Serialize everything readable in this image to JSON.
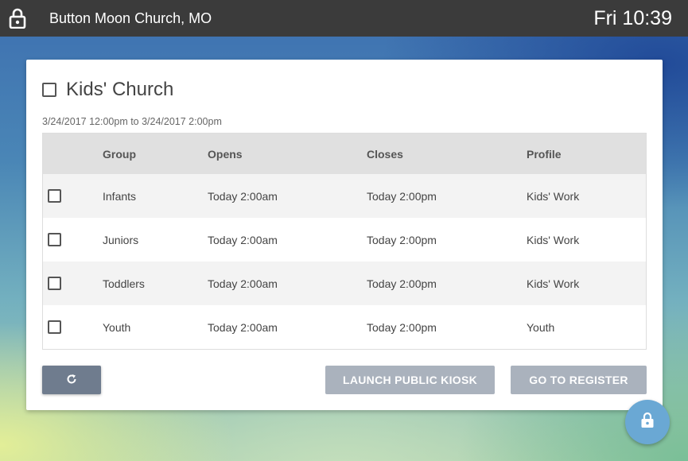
{
  "topbar": {
    "lock_icon": "lock-icon",
    "church_name": "Button Moon Church, MO",
    "clock": "Fri 10:39"
  },
  "event": {
    "title": "Kids' Church",
    "time_range": "3/24/2017 12:00pm to 3/24/2017 2:00pm"
  },
  "table": {
    "headers": {
      "group": "Group",
      "opens": "Opens",
      "closes": "Closes",
      "profile": "Profile"
    },
    "rows": [
      {
        "group": "Infants",
        "opens": "Today 2:00am",
        "closes": "Today 2:00pm",
        "profile": "Kids' Work"
      },
      {
        "group": "Juniors",
        "opens": "Today 2:00am",
        "closes": "Today 2:00pm",
        "profile": "Kids' Work"
      },
      {
        "group": "Toddlers",
        "opens": "Today 2:00am",
        "closes": "Today 2:00pm",
        "profile": "Kids' Work"
      },
      {
        "group": "Youth",
        "opens": "Today 2:00am",
        "closes": "Today 2:00pm",
        "profile": "Youth"
      }
    ]
  },
  "actions": {
    "refresh_icon": "refresh-icon",
    "launch_kiosk": "LAUNCH PUBLIC KIOSK",
    "go_to_register": "GO TO REGISTER"
  },
  "fab": {
    "icon": "lock-icon"
  },
  "colors": {
    "topbar": "#3b3b3b",
    "refresh_button": "#6f7c8e",
    "disabled_button": "#aab2bd",
    "fab": "#6aa8d4"
  }
}
